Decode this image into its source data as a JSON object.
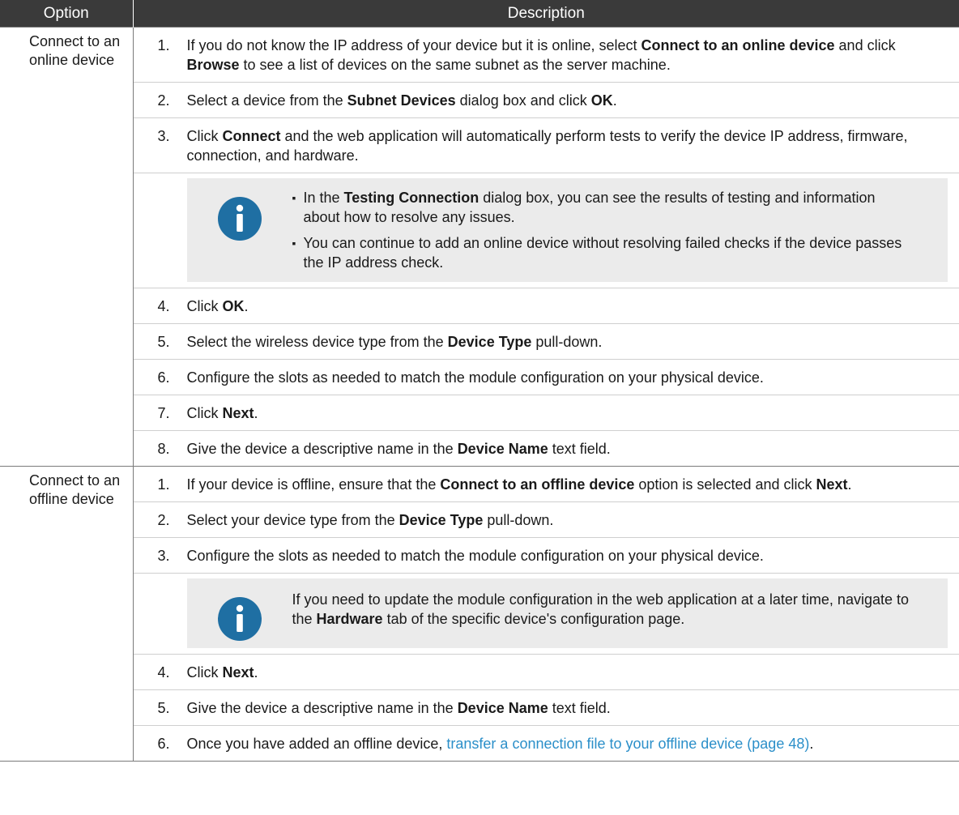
{
  "table": {
    "headers": [
      "Option",
      "Description"
    ],
    "online": {
      "option": "Connect to an online device",
      "steps": [
        {
          "num": "1.",
          "parts": [
            "If you do not know the IP address of your device but it is online, select ",
            "Connect to an online device",
            " and click ",
            "Browse",
            " to see a list of devices on the same subnet as the server machine."
          ]
        },
        {
          "num": "2.",
          "parts": [
            "Select a device from the ",
            "Subnet Devices",
            " dialog box and click ",
            "OK",
            "."
          ]
        },
        {
          "num": "3.",
          "parts": [
            "Click ",
            "Connect",
            " and the web application will automatically perform tests to verify the device IP address, firmware, connection, and hardware."
          ]
        },
        {
          "num": "4.",
          "parts": [
            "Click ",
            "OK",
            "."
          ]
        },
        {
          "num": "5.",
          "parts": [
            "Select the wireless device type from the ",
            "Device Type",
            " pull-down."
          ]
        },
        {
          "num": "6.",
          "parts": [
            "Configure the slots as needed to match the module configuration on your physical device."
          ]
        },
        {
          "num": "7.",
          "parts": [
            "Click ",
            "Next",
            "."
          ]
        },
        {
          "num": "8.",
          "parts": [
            "Give the device a descriptive name in the ",
            "Device Name",
            " text field."
          ]
        }
      ],
      "note_icon": "info-icon",
      "note_bullets": [
        [
          "In the ",
          "Testing Connection",
          " dialog box, you can see the results of testing and information about how to resolve any issues."
        ],
        [
          "You can continue to add an online device without resolving failed checks if the device passes the IP address check."
        ]
      ]
    },
    "offline": {
      "option": "Connect to an offline device",
      "steps": [
        {
          "num": "1.",
          "parts": [
            "If your device is offline, ensure that the ",
            "Connect to an offline device",
            " option is selected and click ",
            "Next",
            "."
          ]
        },
        {
          "num": "2.",
          "parts": [
            "Select your device type from the ",
            "Device Type",
            " pull-down."
          ]
        },
        {
          "num": "3.",
          "parts": [
            "Configure the slots as needed to match the module configuration on your physical device."
          ]
        },
        {
          "num": "4.",
          "parts": [
            "Click ",
            "Next",
            "."
          ]
        },
        {
          "num": "5.",
          "parts": [
            "Give the device a descriptive name in the ",
            "Device Name",
            " text field."
          ]
        },
        {
          "num": "6.",
          "parts": [
            "Once you have added an offline device, ",
            "transfer a connection file to your offline device (page 48)",
            "."
          ]
        }
      ],
      "note_icon": "info-icon",
      "note_parts": [
        "If you need to update the module configuration in the web application at a later time, navigate to the ",
        "Hardware",
        " tab of the specific device's configuration page."
      ]
    }
  },
  "colors": {
    "header_bg": "#3a3a3a",
    "note_bg": "#ebebeb",
    "icon": "#1f6fa3",
    "link": "#2b8fc9"
  }
}
